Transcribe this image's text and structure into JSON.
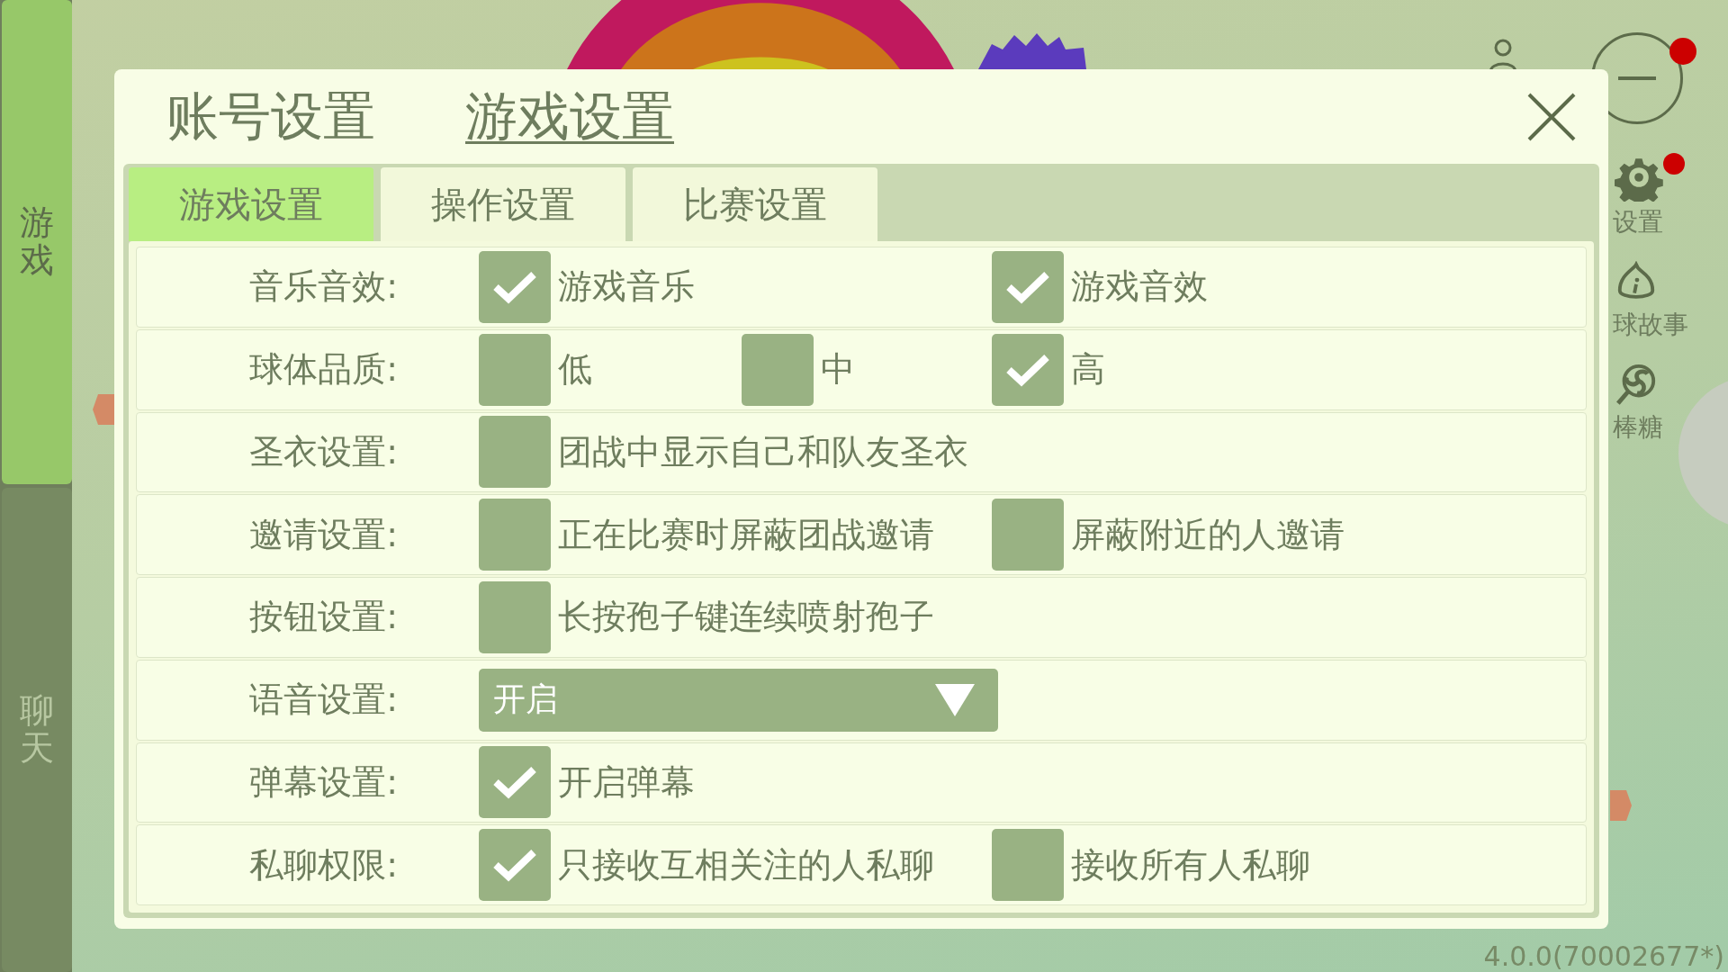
{
  "sidebar": {
    "tabs": [
      {
        "label": "游戏",
        "selected": true
      },
      {
        "label": "聊天",
        "selected": false
      }
    ]
  },
  "dialog": {
    "tabs": [
      {
        "label": "账号设置",
        "selected": false
      },
      {
        "label": "游戏设置",
        "selected": true
      }
    ],
    "subtabs": [
      {
        "label": "游戏设置",
        "selected": true
      },
      {
        "label": "操作设置",
        "selected": false
      },
      {
        "label": "比赛设置",
        "selected": false
      }
    ],
    "rows": [
      {
        "label": "音乐音效:",
        "kind": "options",
        "options": [
          {
            "label": "游戏音乐",
            "checked": true
          },
          {
            "label": "游戏音效",
            "checked": true
          }
        ]
      },
      {
        "label": "球体品质:",
        "kind": "options",
        "options": [
          {
            "label": "低",
            "checked": false
          },
          {
            "label": "中",
            "checked": false
          },
          {
            "label": "高",
            "checked": true
          }
        ]
      },
      {
        "label": "圣衣设置:",
        "kind": "options",
        "options": [
          {
            "label": "团战中显示自己和队友圣衣",
            "checked": false
          }
        ]
      },
      {
        "label": "邀请设置:",
        "kind": "options",
        "options": [
          {
            "label": "正在比赛时屏蔽团战邀请",
            "checked": false
          },
          {
            "label": "屏蔽附近的人邀请",
            "checked": false
          }
        ]
      },
      {
        "label": "按钮设置:",
        "kind": "options",
        "options": [
          {
            "label": "长按孢子键连续喷射孢子",
            "checked": false
          }
        ]
      },
      {
        "label": "语音设置:",
        "kind": "dropdown",
        "value": "开启"
      },
      {
        "label": "弹幕设置:",
        "kind": "options",
        "options": [
          {
            "label": "开启弹幕",
            "checked": true
          }
        ]
      },
      {
        "label": "私聊权限:",
        "kind": "options",
        "options": [
          {
            "label": "只接收互相关注的人私聊",
            "checked": true
          },
          {
            "label": "接收所有人私聊",
            "checked": false
          }
        ]
      }
    ]
  },
  "hud": {
    "minimize_badge": true,
    "items": [
      {
        "kind": "gear",
        "label": "设置",
        "badge": true
      },
      {
        "kind": "info",
        "label": "球故事"
      },
      {
        "kind": "lollipop",
        "label": "棒糖"
      }
    ]
  },
  "version": "4.0.0(70002677*)"
}
